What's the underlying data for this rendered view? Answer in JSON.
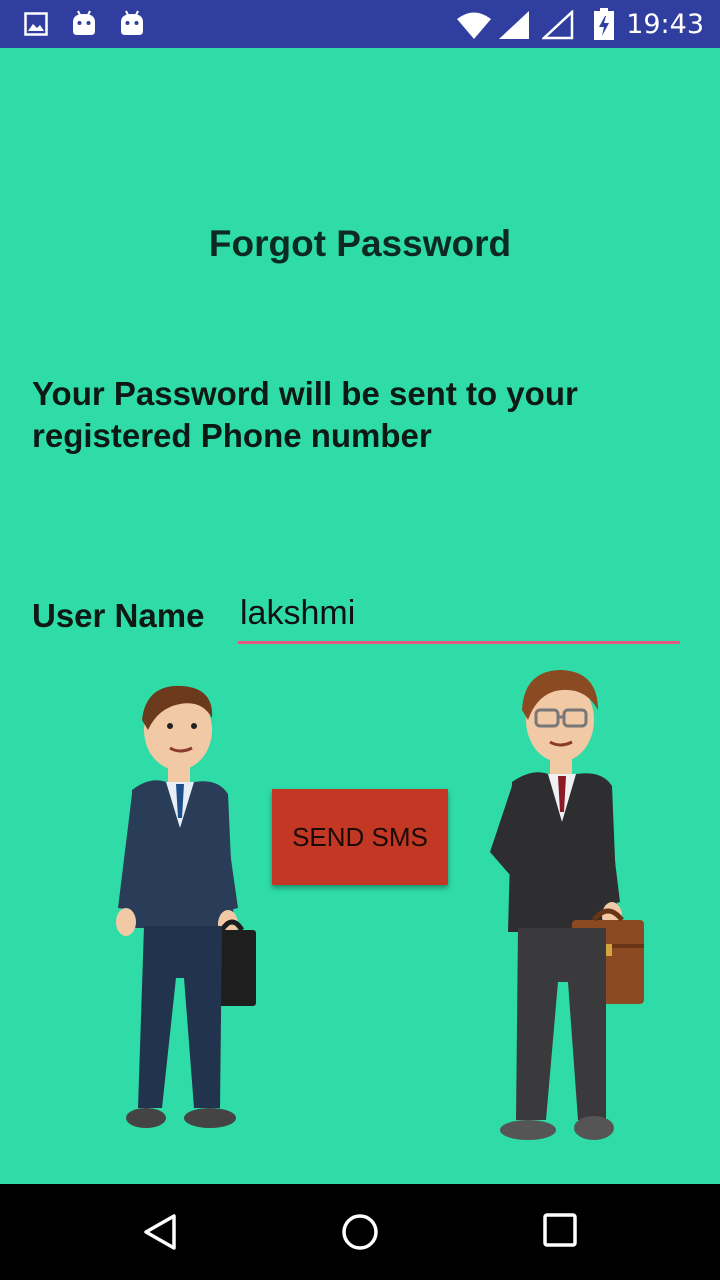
{
  "status_bar": {
    "time": "19:43",
    "icons": [
      "image-icon",
      "android-icon",
      "android-icon",
      "wifi-icon",
      "signal-icon",
      "signal-empty-icon",
      "battery-charging-icon"
    ]
  },
  "screen": {
    "title": "Forgot Password",
    "info_text": "Your Password will be sent to your registered Phone number",
    "username_label": "User Name",
    "username_value": "lakshmi",
    "send_button_label": "SEND SMS"
  },
  "nav_bar": {
    "icons": [
      "back-icon",
      "home-icon",
      "recents-icon"
    ]
  },
  "colors": {
    "background": "#2fdca8",
    "status_bar": "#303f9f",
    "button": "#c33825",
    "input_underline": "#e8577f"
  }
}
